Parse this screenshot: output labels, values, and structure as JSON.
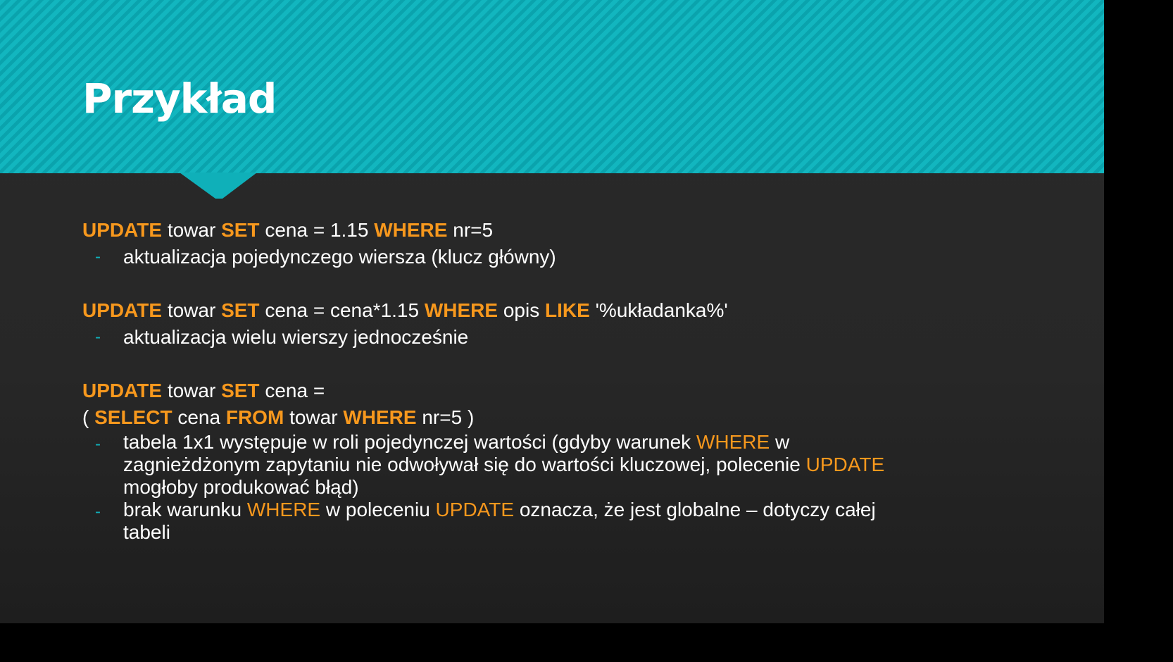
{
  "colors": {
    "header_teal": "#0fb0b9",
    "keyword_orange": "#f7981d",
    "bullet_teal": "#10b2bc",
    "body_bg": "#272727",
    "text": "#ffffff"
  },
  "title": "Przykład",
  "examples": [
    {
      "lines": [
        [
          {
            "t": "UPDATE",
            "kw": true
          },
          {
            "t": " towar "
          },
          {
            "t": "SET",
            "kw": true
          },
          {
            "t": " cena = 1.15 "
          },
          {
            "t": "WHERE",
            "kw": true
          },
          {
            "t": " nr=5"
          }
        ]
      ],
      "bullets": [
        [
          "aktualizacja pojedynczego wiersza (klucz główny)"
        ]
      ]
    },
    {
      "lines": [
        [
          {
            "t": "UPDATE",
            "kw": true
          },
          {
            "t": " towar "
          },
          {
            "t": "SET",
            "kw": true
          },
          {
            "t": " cena = cena*1.15 "
          },
          {
            "t": "WHERE",
            "kw": true
          },
          {
            "t": " opis "
          },
          {
            "t": "LIKE",
            "kw": true
          },
          {
            "t": " '%układanka%'"
          }
        ]
      ],
      "bullets": [
        [
          "aktualizacja wielu wierszy jednocześnie"
        ]
      ]
    },
    {
      "lines": [
        [
          {
            "t": "UPDATE",
            "kw": true
          },
          {
            "t": " towar "
          },
          {
            "t": "SET",
            "kw": true
          },
          {
            "t": " cena ="
          }
        ],
        [
          {
            "t": "( "
          },
          {
            "t": "SELECT",
            "kw": true
          },
          {
            "t": " cena "
          },
          {
            "t": "FROM",
            "kw": true
          },
          {
            "t": " towar "
          },
          {
            "t": "WHERE",
            "kw": true
          },
          {
            "t": " nr=5 )"
          }
        ]
      ],
      "bullets": [
        [
          "tabela 1x1 występuje w roli pojedynczej wartości (gdyby warunek WHERE w",
          "zagnieżdżonym zapytaniu nie odwoływał się do wartości kluczowej, polecenie UPDATE",
          "mogłoby produkować błąd)"
        ],
        [
          "brak warunku WHERE w poleceniu UPDATE oznacza, że jest globalne – dotyczy całej",
          "tabeli"
        ]
      ]
    }
  ],
  "highlight_words": [
    "WHERE",
    "UPDATE"
  ],
  "bullet_dash": "-"
}
